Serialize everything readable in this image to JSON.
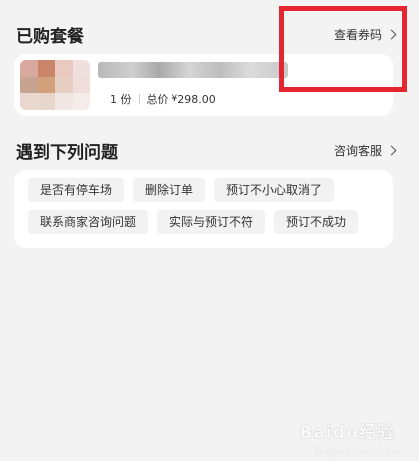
{
  "purchased": {
    "title": "已购套餐",
    "view_coupon_link": "查看券码",
    "package": {
      "quantity": "1 份",
      "total_label": "总价",
      "currency": "¥",
      "price": "298.00"
    }
  },
  "issues": {
    "title": "遇到下列问题",
    "support_link": "咨询客服",
    "chips_row1": [
      "是否有停车场",
      "删除订单",
      "预订不小心取消了"
    ],
    "chips_row2": [
      "联系商家咨询问题",
      "实际与预订不符",
      "预订不成功"
    ]
  },
  "colors": {
    "page_bg": "#f3f3f3",
    "highlight": "#e3262f"
  },
  "watermark": {
    "main": "Baidu经验",
    "sub": "jingyan.baidu.com"
  }
}
